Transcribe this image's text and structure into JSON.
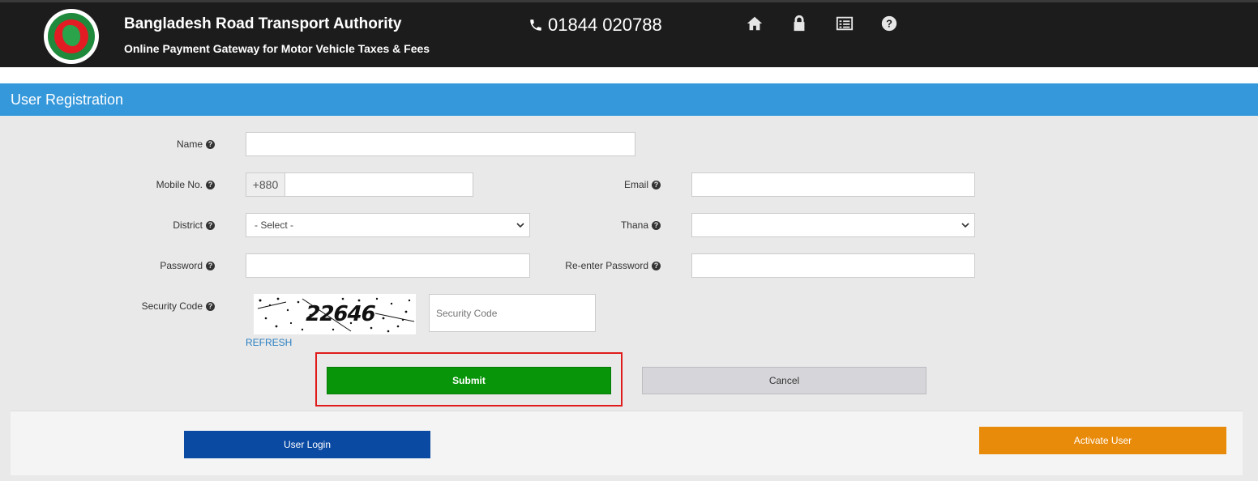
{
  "header": {
    "title": "Bangladesh Road Transport Authority",
    "subtitle": "Online Payment Gateway for Motor Vehicle Taxes & Fees",
    "phone": "01844 020788",
    "nav_icons": [
      "home-icon",
      "lock-icon",
      "list-icon",
      "help-icon"
    ]
  },
  "panel": {
    "title": "User Registration"
  },
  "form": {
    "name_label": "Name",
    "mobile_label": "Mobile No.",
    "mobile_prefix": "+880",
    "email_label": "Email",
    "district_label": "District",
    "district_value": "- Select -",
    "thana_label": "Thana",
    "thana_value": "",
    "password_label": "Password",
    "repassword_label": "Re-enter Password",
    "security_label": "Security Code",
    "security_placeholder": "Security Code",
    "captcha_text": "22646",
    "refresh_label": "REFRESH"
  },
  "buttons": {
    "submit": "Submit",
    "cancel": "Cancel",
    "login": "User Login",
    "activate": "Activate User"
  },
  "colors": {
    "header_bg": "#1c1c1c",
    "panel_head": "#3598db",
    "submit": "#099509",
    "login": "#0a4aa3",
    "activate": "#e98b0a",
    "highlight": "#e01b1b"
  }
}
